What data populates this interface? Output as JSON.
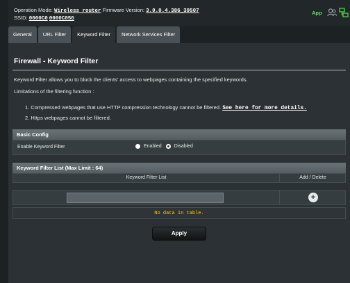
{
  "header": {
    "operation_mode_label": "Operation Mode:",
    "operation_mode_value": "Wireless router",
    "firmware_label": "Firmware Version:",
    "firmware_value": "3.0.0.4.386_39507",
    "ssid_label": "SSID:",
    "ssid_1": "0000C0",
    "ssid_2": "0000C05G",
    "app_label": "App",
    "user_icon": "user-icon",
    "network_icon": "network-map-icon",
    "accent_color": "#66e066"
  },
  "tabs": [
    {
      "label": "General",
      "active": false
    },
    {
      "label": "URL Filter",
      "active": false
    },
    {
      "label": "Keyword Filter",
      "active": true
    },
    {
      "label": "Network Services Filter",
      "active": false
    }
  ],
  "main": {
    "title": "Firewall - Keyword Filter",
    "description": "Keyword Filter allows you to block the clients' access to webpages containing the specified keywords.",
    "limitations_heading": "Limitations of the filtering function :",
    "limitation_1": "1. Compressed webpages that use HTTP compression technology cannot be filtered.",
    "limitation_1_link": "See here for more details.",
    "limitation_2": "2. Https webpages cannot be filtered."
  },
  "basic_config": {
    "heading": "Basic Config",
    "enable_label": "Enable Keyword Filter",
    "options": [
      "Enabled",
      "Disabled"
    ],
    "selected": "Disabled"
  },
  "keyword_list": {
    "heading": "Keyword Filter List (Max Limit : 64)",
    "col_list": "Keyword Filter List",
    "col_add_delete": "Add / Delete",
    "input_value": "",
    "add_icon": "plus-circle-icon",
    "empty_message": "No data in table."
  },
  "actions": {
    "apply_label": "Apply"
  }
}
